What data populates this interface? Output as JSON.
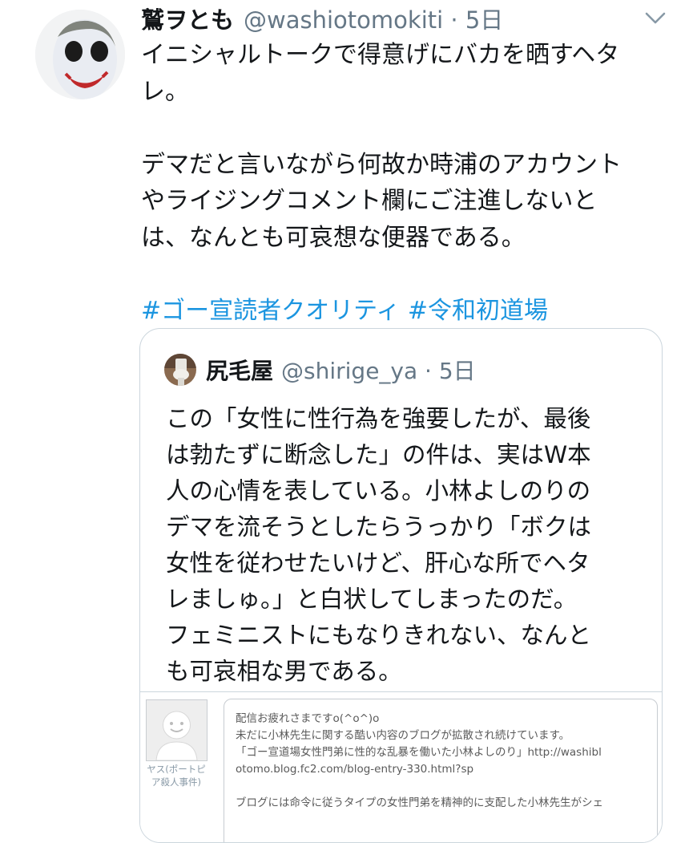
{
  "tweet": {
    "display_name": "鷲ヲとも",
    "handle_time": "@washiotomokiti · 5日",
    "lines": [
      "イニシャルトークで得意げにバカを晒すヘタ",
      "レ。",
      "",
      "デマだと言いながら何故か時浦のアカウント",
      "やライジングコメント欄にご注進しないと",
      "は、なんとも可哀想な便器である。",
      ""
    ],
    "hashtag1": "#ゴー宣読者クオリティ",
    "hashtag2": "#令和初道場",
    "menu_icon": "chevron-down-icon"
  },
  "quote": {
    "display_name": "尻毛屋",
    "handle_time": "@shirige_ya · 5日",
    "lines": [
      "この「女性に性行為を強要したが、最後",
      "は勃たずに断念した」の件は、実はW本",
      "人の心情を表している。小林よしのりの",
      "デマを流そうとしたらうっかり「ボクは",
      "女性を従わせたいけど、肝心な所でヘタ",
      "レましゅ。」と白状してしまったのだ。",
      "フェミニストにもなりきれない、なんと",
      "も可哀相な男である。"
    ]
  },
  "embed": {
    "caption_line1": "ヤス(ポートピ",
    "caption_line2": "ア殺人事件)",
    "lines": [
      "配信お疲れさまですo(^o^)o",
      "未だに小林先生に関する酷い内容のブログが拡散され続けています。",
      "「ゴー宣道場女性門弟に性的な乱暴を働いた小林よしのり」http://washibl",
      "otomo.blog.fc2.com/blog-entry-330.html?sp",
      "",
      "ブログには命令に従うタイプの女性門弟を精神的に支配した小林先生がシェ"
    ]
  },
  "colors": {
    "link": "#1b95e0",
    "secondary": "#657786",
    "border": "#ccd6dd"
  }
}
